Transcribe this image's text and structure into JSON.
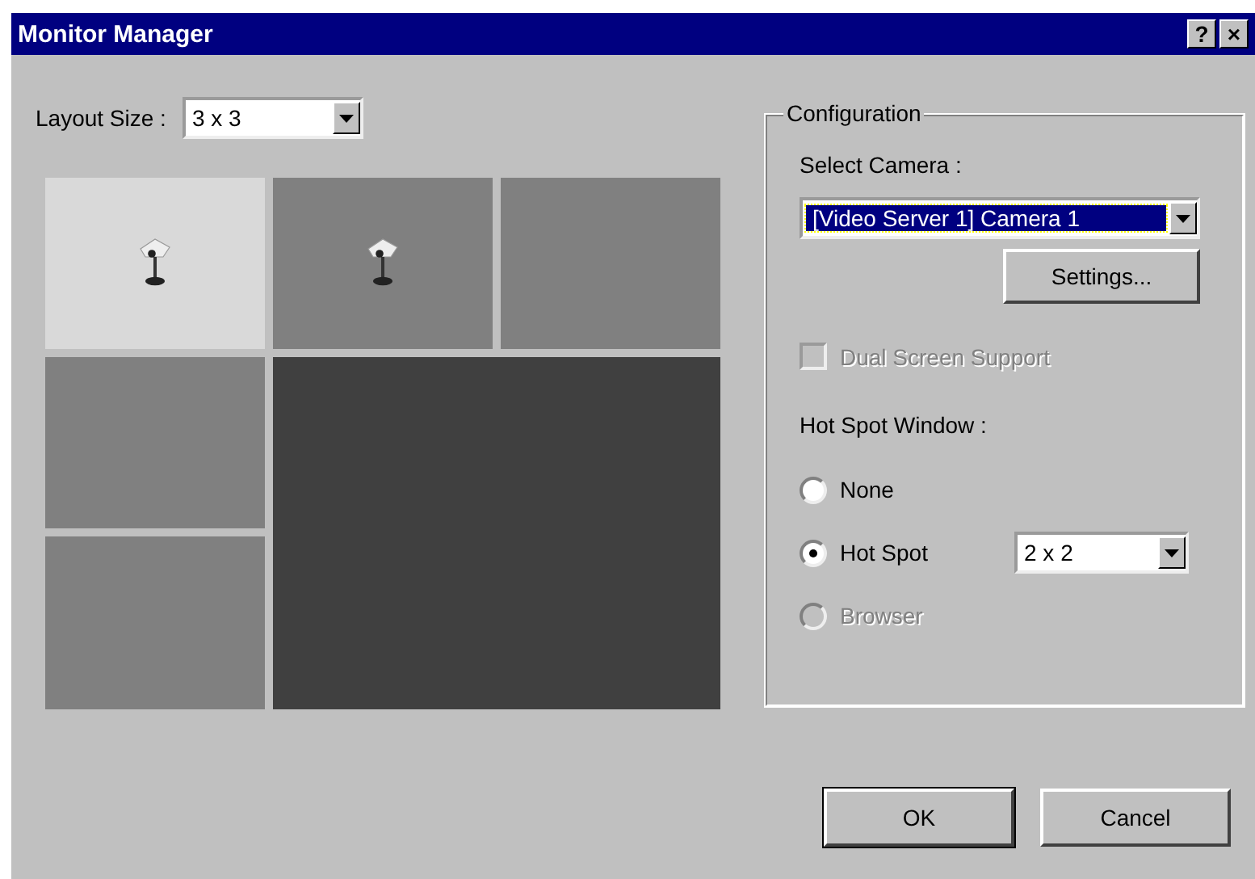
{
  "window": {
    "title": "Monitor Manager",
    "title_buttons": [
      "?",
      "×"
    ]
  },
  "layout_size": {
    "label": "Layout Size :",
    "value": "3 x 3"
  },
  "layout_cells": [
    {
      "kind": "camera",
      "selected": true
    },
    {
      "kind": "camera",
      "selected": false
    },
    {
      "kind": "empty",
      "selected": false
    },
    {
      "kind": "empty",
      "selected": false
    },
    {
      "kind": "hotspot",
      "selected": false
    },
    {
      "kind": "empty",
      "selected": false
    }
  ],
  "configuration": {
    "title": "Configuration",
    "select_camera_label": "Select Camera :",
    "camera": "[Video Server 1] Camera 1",
    "settings_button": "Settings...",
    "dual_screen": {
      "label": "Dual Screen Support",
      "checked": false,
      "disabled": true
    },
    "hot_spot_label": "Hot Spot Window :",
    "hot_spot_options": [
      {
        "label": "None",
        "selected": false,
        "disabled": false
      },
      {
        "label": "Hot Spot",
        "selected": true,
        "disabled": false
      },
      {
        "label": "Browser",
        "selected": false,
        "disabled": true
      }
    ],
    "hot_spot_size": "2 x 2"
  },
  "buttons": [
    "OK",
    "Cancel"
  ]
}
